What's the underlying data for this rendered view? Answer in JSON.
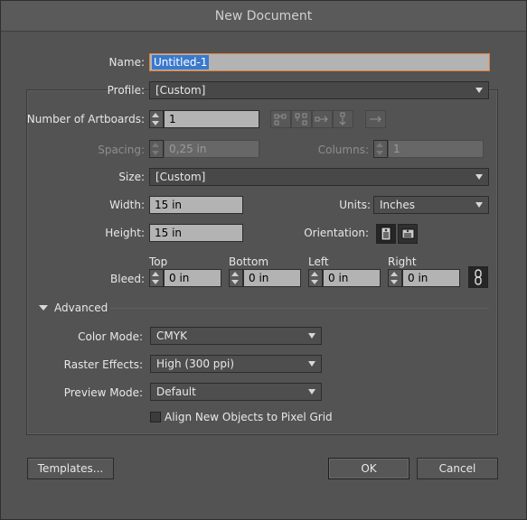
{
  "window": {
    "title": "New Document"
  },
  "name": {
    "label": "Name:",
    "value": "Untitled-1"
  },
  "profile": {
    "label": "Profile:",
    "value": "[Custom]"
  },
  "artboards": {
    "label": "Number of Artboards:",
    "value": "1"
  },
  "spacing": {
    "label": "Spacing:",
    "value": "0,25 in"
  },
  "columns": {
    "label": "Columns:",
    "value": "1"
  },
  "size": {
    "label": "Size:",
    "value": "[Custom]"
  },
  "width": {
    "label": "Width:",
    "value": "15 in"
  },
  "units": {
    "label": "Units:",
    "value": "Inches"
  },
  "height": {
    "label": "Height:",
    "value": "15 in"
  },
  "orientation": {
    "label": "Orientation:",
    "selected": "portrait"
  },
  "bleed": {
    "label": "Bleed:",
    "top_label": "Top",
    "top": "0 in",
    "bottom_label": "Bottom",
    "bottom": "0 in",
    "left_label": "Left",
    "left": "0 in",
    "right_label": "Right",
    "right": "0 in"
  },
  "advanced": {
    "label": "Advanced",
    "expanded": true,
    "color_mode": {
      "label": "Color Mode:",
      "value": "CMYK"
    },
    "raster": {
      "label": "Raster Effects:",
      "value": "High (300 ppi)"
    },
    "preview": {
      "label": "Preview Mode:",
      "value": "Default"
    },
    "align": {
      "label": "Align New Objects to Pixel Grid",
      "checked": false
    }
  },
  "buttons": {
    "templates": "Templates...",
    "ok": "OK",
    "cancel": "Cancel"
  },
  "colors": {
    "background": "#535353",
    "field": "#b3b3b3",
    "focus": "#e2803a",
    "selection": "#3a79cc"
  },
  "icons": {
    "arrange": [
      "grid-by-row-icon",
      "grid-by-column-icon",
      "arrange-by-row-icon",
      "arrange-by-column-icon"
    ],
    "layout_direction": "right-to-left-arrow-icon",
    "orientation": [
      "portrait-icon",
      "landscape-icon"
    ],
    "bleed_link": "chain-link-icon"
  }
}
